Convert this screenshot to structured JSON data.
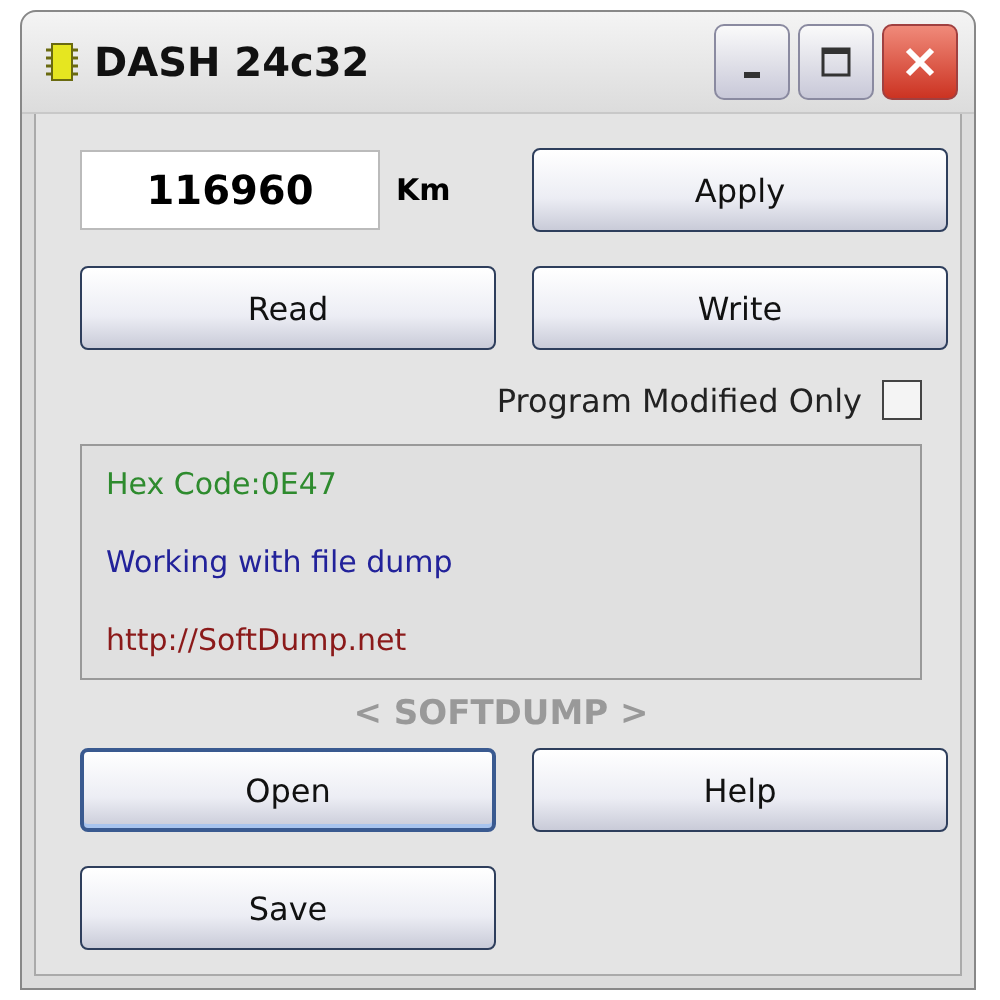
{
  "window": {
    "title": "DASH 24c32"
  },
  "mileage": {
    "value": "116960",
    "unit": "Km"
  },
  "top_buttons": [
    {
      "label": "Apply",
      "focused": false
    },
    {
      "label": "Read",
      "focused": false
    },
    {
      "label": "Write",
      "focused": false
    }
  ],
  "program_modified_only": {
    "label": "Program Modified Only",
    "checked": false
  },
  "log": [
    {
      "text": "Hex Code:0E47",
      "color": "#2e8b2e"
    },
    {
      "text": "Working with file dump",
      "color": "#22229a"
    },
    {
      "text": "http://SoftDump.net",
      "color": "#8b1a1a"
    }
  ],
  "brand": "< SOFTDUMP >",
  "bottom_buttons": [
    {
      "label": "Open",
      "focused": true
    },
    {
      "label": "Help",
      "focused": false
    },
    {
      "label": "Save",
      "focused": false
    }
  ]
}
